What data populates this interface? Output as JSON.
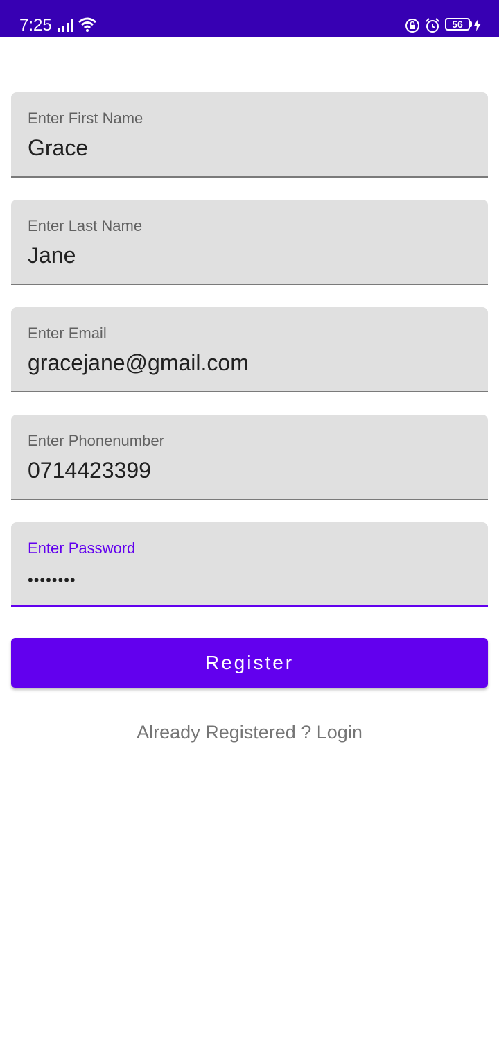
{
  "status_bar": {
    "time": "7:25",
    "battery": "56",
    "background": "#3700B3",
    "icons": [
      "signal-icon",
      "wifi-icon",
      "lock-rotation-icon",
      "alarm-icon",
      "battery-icon",
      "charging-icon"
    ]
  },
  "form": {
    "first_name": {
      "label": "Enter First Name",
      "value": "Grace"
    },
    "last_name": {
      "label": "Enter Last Name",
      "value": "Jane"
    },
    "email": {
      "label": "Enter Email",
      "value": "gracejane@gmail.com"
    },
    "phone": {
      "label": "Enter Phonenumber",
      "value": "0714423399"
    },
    "password": {
      "label": "Enter Password",
      "value": "••••••••"
    }
  },
  "register_button": {
    "label": "Register",
    "color": "#6200EE"
  },
  "login_link": {
    "label": "Already Registered ? Login"
  },
  "colors": {
    "accent": "#6200EE",
    "field_bg": "#e0e0e0",
    "label": "#616161"
  }
}
